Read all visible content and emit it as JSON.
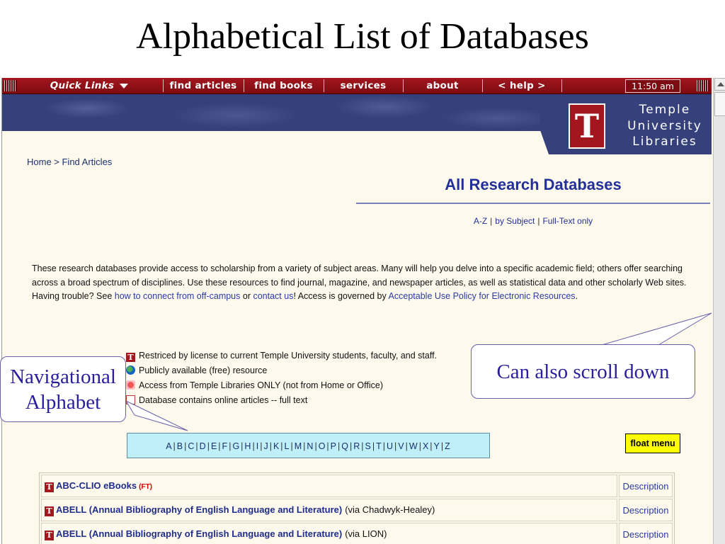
{
  "slide": {
    "title": "Alphabetical List of  Databases"
  },
  "topnav": {
    "quick_links": "Quick Links",
    "items": [
      "find articles",
      "find books",
      "services",
      "about",
      "< help >"
    ],
    "clock": "11:50 am"
  },
  "banner": {
    "logo_letter": "T",
    "logo_text_line1": "Temple",
    "logo_text_line2": "University",
    "logo_text_line3": "Libraries"
  },
  "breadcrumb": "Home > Find Articles",
  "heading": "All Research Databases",
  "subnav": {
    "az": "A-Z",
    "by_subject": "by Subject",
    "full_text": "Full-Text only"
  },
  "intro": {
    "text1": "These research databases provide access to scholarship from a variety of subject areas. Many will help you delve into a specific academic field; others offer searching across a broad spectrum of disciplines. Use these resources to find journal, magazine, and newspaper articles, as well as statistical data and other scholarly Web sites. Having trouble? See ",
    "link1": "how to connect from off-campus",
    "text2": " or ",
    "link2": "contact us",
    "text3": "! Access is governed by ",
    "link3": "Acceptable Use Policy for Electronic Resources",
    "text4": "."
  },
  "legend": [
    "Restriced by license to current Temple University students, faculty, and staff.",
    "Publicly available (free) resource",
    "Access from Temple Libraries ONLY (not from Home or Office)",
    "Database contains online articles -- full text"
  ],
  "alphabet": [
    "A",
    "B",
    "C",
    "D",
    "E",
    "F",
    "G",
    "H",
    "I",
    "J",
    "K",
    "L",
    "M",
    "N",
    "O",
    "P",
    "Q",
    "R",
    "S",
    "T",
    "U",
    "V",
    "W",
    "X",
    "Y",
    "Z"
  ],
  "float_menu": "float menu",
  "databases": [
    {
      "name": "ABC-CLIO eBooks",
      "ft": "(FT)",
      "via": "",
      "description": "Description"
    },
    {
      "name": "ABELL (Annual Bibliography of English Language and Literature)",
      "ft": "",
      "via": "(via Chadwyk-Healey)",
      "description": "Description"
    },
    {
      "name": "ABELL (Annual Bibliography of English Language and Literature)",
      "ft": "",
      "via": "(via LION)",
      "description": "Description"
    }
  ],
  "callouts": {
    "navigational_line1": "Navigational",
    "navigational_line2": "Alphabet",
    "scroll": "Can also scroll down"
  }
}
